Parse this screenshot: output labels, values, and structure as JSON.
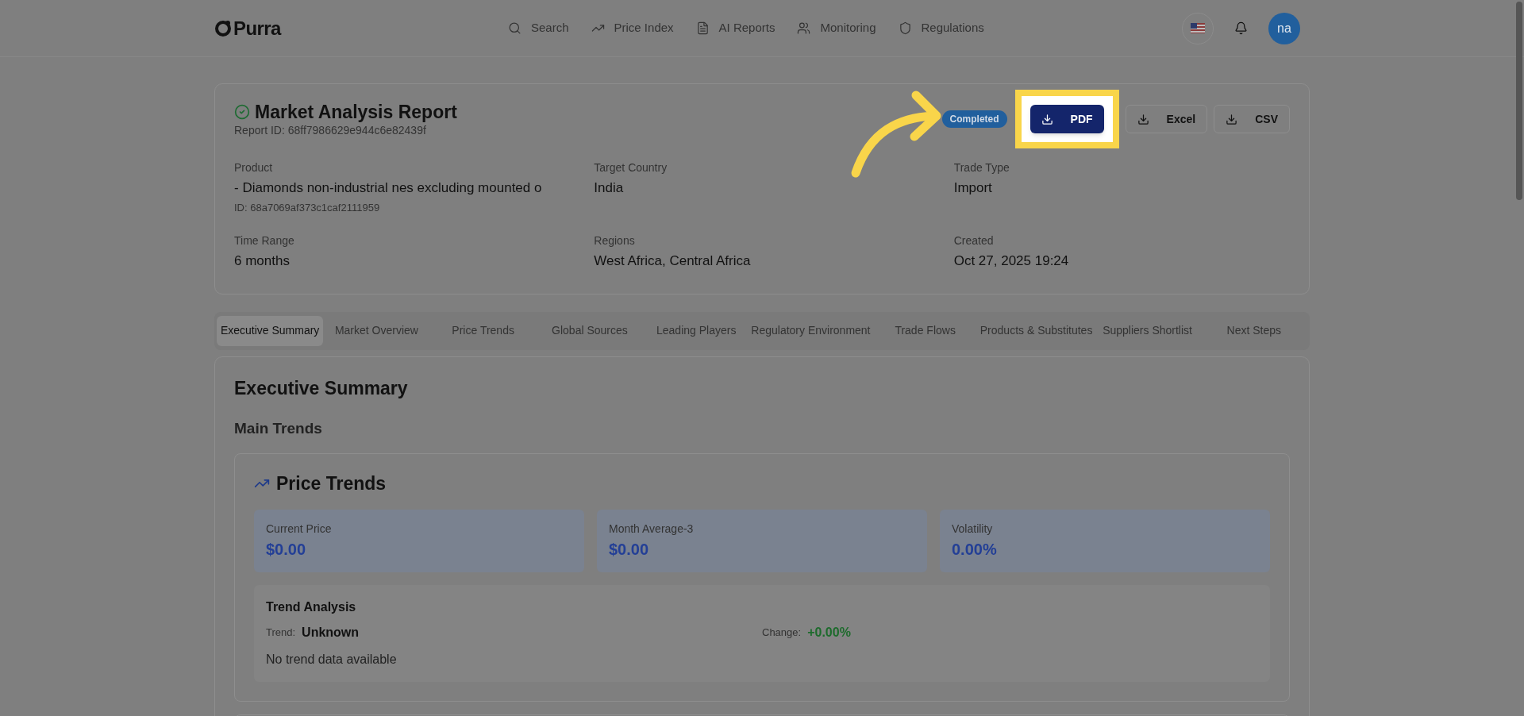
{
  "header": {
    "logo": "Purra",
    "nav": [
      {
        "label": "Search"
      },
      {
        "label": "Price Index"
      },
      {
        "label": "AI Reports"
      },
      {
        "label": "Monitoring"
      },
      {
        "label": "Regulations"
      }
    ],
    "avatar": "na"
  },
  "report": {
    "title": "Market Analysis Report",
    "report_id": "Report ID: 68ff7986629e944c6e82439f",
    "status": "Completed",
    "exports": [
      {
        "label": "PDF",
        "highlighted": true
      },
      {
        "label": "Excel",
        "highlighted": false
      },
      {
        "label": "CSV",
        "highlighted": false
      }
    ],
    "fields": [
      {
        "label": "Product",
        "value": "- Diamonds non-industrial nes excluding mounted o",
        "sub": "ID: 68a7069af373c1caf2111959"
      },
      {
        "label": "Target Country",
        "value": "India"
      },
      {
        "label": "Trade Type",
        "value": "Import"
      },
      {
        "label": "Time Range",
        "value": "6 months"
      },
      {
        "label": "Regions",
        "value": "West Africa, Central Africa"
      },
      {
        "label": "Created",
        "value": "Oct 27, 2025 19:24"
      }
    ]
  },
  "tabs": [
    {
      "label": "Executive Summary",
      "selected": true
    },
    {
      "label": "Market Overview",
      "selected": false
    },
    {
      "label": "Price Trends",
      "selected": false
    },
    {
      "label": "Global Sources",
      "selected": false
    },
    {
      "label": "Leading Players",
      "selected": false
    },
    {
      "label": "Regulatory Environment",
      "selected": false
    },
    {
      "label": "Trade Flows",
      "selected": false
    },
    {
      "label": "Products & Substitutes",
      "selected": false
    },
    {
      "label": "Suppliers Shortlist",
      "selected": false
    },
    {
      "label": "Next Steps",
      "selected": false
    }
  ],
  "section": {
    "title": "Executive Summary",
    "subtitle": "Main Trends",
    "price_trends": {
      "title": "Price Trends",
      "stats": [
        {
          "label": "Current Price",
          "value": "$0.00"
        },
        {
          "label": "Month Average-3",
          "value": "$0.00"
        },
        {
          "label": "Volatility",
          "value": "0.00%"
        }
      ],
      "analysis": {
        "title": "Trend Analysis",
        "trend_label": "Trend:",
        "trend_value": "Unknown",
        "change_label": "Change:",
        "change_value": "+0.00%",
        "note": "No trend data available"
      }
    }
  }
}
